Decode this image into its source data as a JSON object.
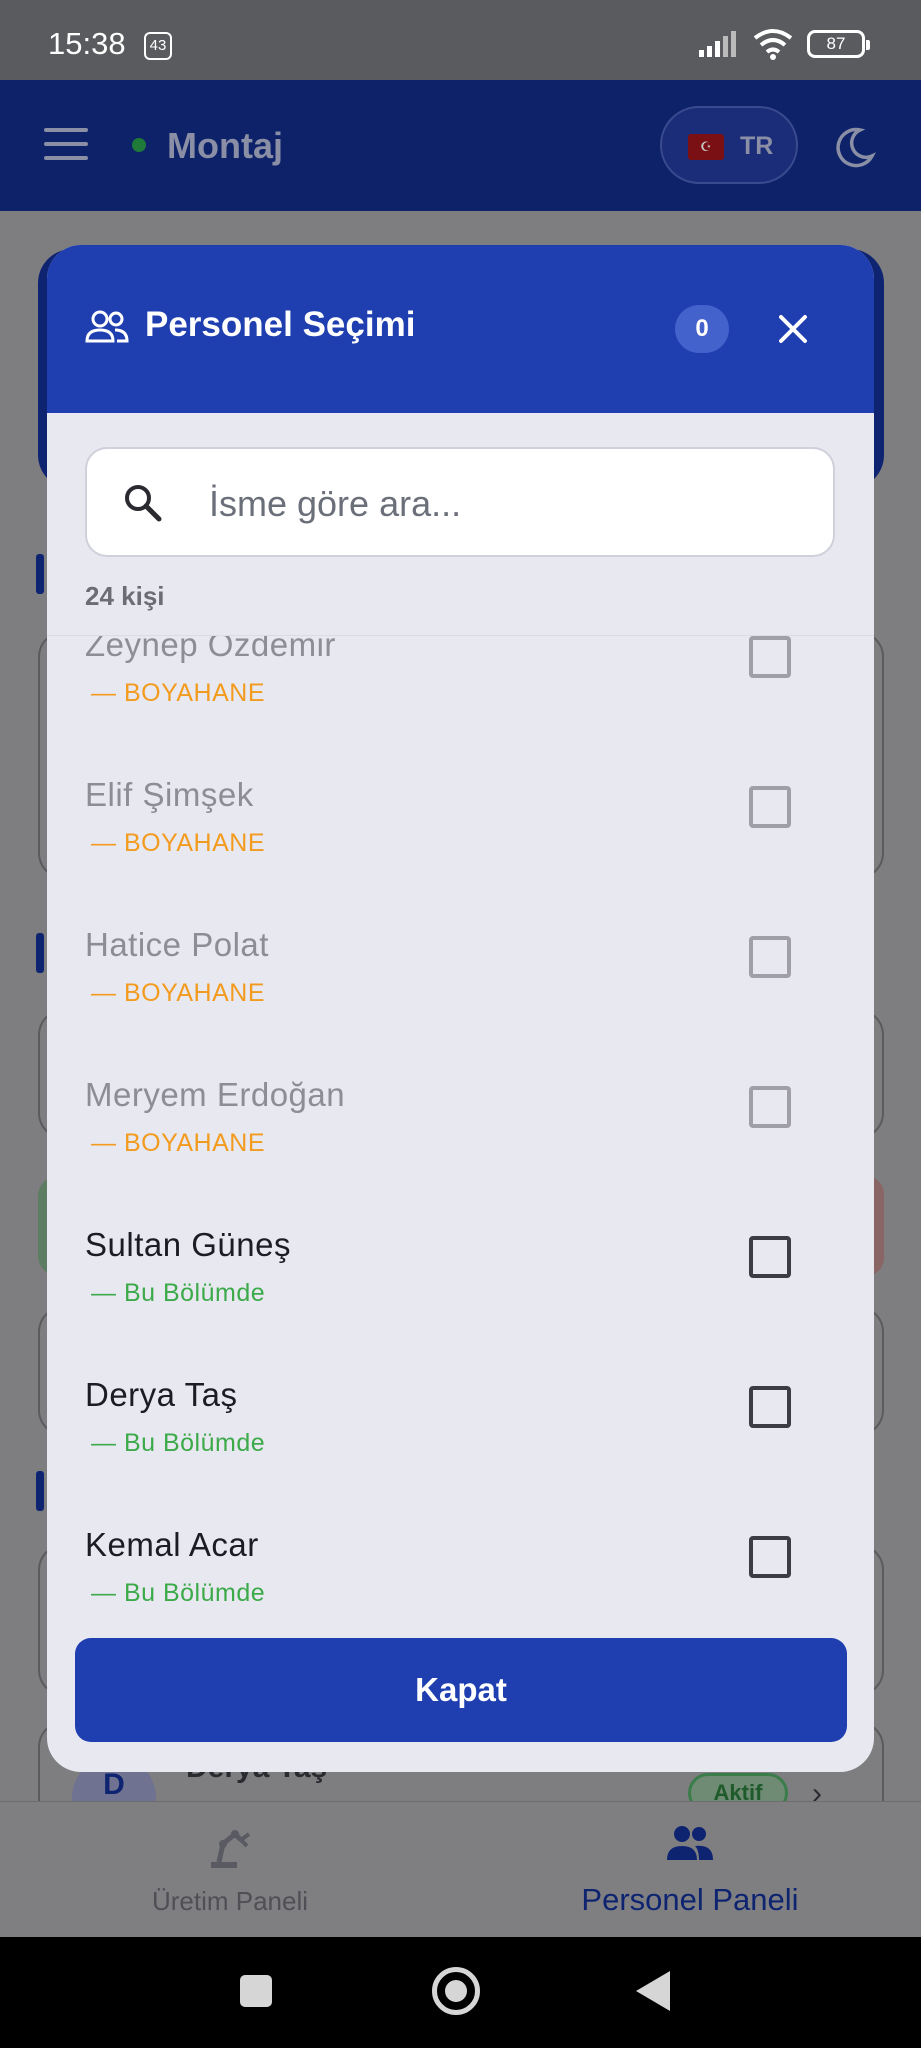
{
  "status_bar": {
    "time": "15:38",
    "notification_badge": "43",
    "battery": "87"
  },
  "app_bar": {
    "title": "Montaj",
    "language": "TR",
    "flag": "☪"
  },
  "background": {
    "visible_row_name": "Derya Taş",
    "visible_row_avatar": "D",
    "visible_row_status": "Aktif"
  },
  "bottom_nav": {
    "items": [
      {
        "label": "Üretim Paneli"
      },
      {
        "label": "Personel Paneli"
      }
    ]
  },
  "modal": {
    "title": "Personel Seçimi",
    "selected_count": "0",
    "search_placeholder": "İsme göre ara...",
    "count_label": "24 kişi",
    "close_button": "Kapat",
    "people": [
      {
        "name": "Zeynep Özdemir",
        "dept": "— BOYAHANE",
        "available": false
      },
      {
        "name": "Elif Şimşek",
        "dept": "— BOYAHANE",
        "available": false
      },
      {
        "name": "Hatice Polat",
        "dept": "— BOYAHANE",
        "available": false
      },
      {
        "name": "Meryem Erdoğan",
        "dept": "— BOYAHANE",
        "available": false
      },
      {
        "name": "Sultan Güneş",
        "dept": "— Bu Bölümde",
        "available": true
      },
      {
        "name": "Derya Taş",
        "dept": "— Bu Bölümde",
        "available": true
      },
      {
        "name": "Kemal Acar",
        "dept": "— Bu Bölümde",
        "available": true
      }
    ]
  },
  "colors": {
    "primary": "#1f3fb0",
    "app_bar_dim": "#0d2268",
    "dept_other": "#f29b1e",
    "dept_here": "#3daa4a"
  }
}
